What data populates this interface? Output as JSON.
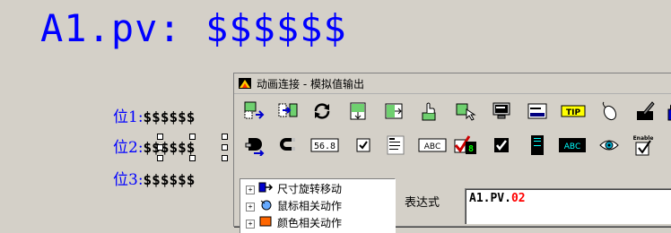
{
  "canvas": {
    "title_text": "A1.pv: $$$$$$",
    "positions": [
      {
        "label": "位1:",
        "value": "$$$$$$"
      },
      {
        "label": "位2:",
        "value": "$$$$$$"
      },
      {
        "label": "位3:",
        "value": "$$$$$$"
      }
    ]
  },
  "dialog": {
    "title": "动画连接 - 模拟值输出",
    "tree_items": [
      {
        "label": "尺寸旋转移动",
        "expander": "+"
      },
      {
        "label": "鼠标相关动作",
        "expander": "+"
      },
      {
        "label": "颜色相关动作",
        "expander": "+"
      }
    ],
    "expression_label": "表达式",
    "expression": {
      "variable": "A1",
      "dot": ".",
      "field": "PV",
      "suffix": ".",
      "index": "02"
    },
    "toolbar_row1": [
      "resize-icon",
      "move-icon",
      "rotate-icon",
      "fill-vertical-icon",
      "fill-horizontal-icon",
      "hand-click-icon",
      "drag-icon",
      "monitor-icon",
      "window-icon",
      "tip-icon",
      "mouse-icon",
      "pen-icon",
      "lock-icon"
    ],
    "toolbar_row2": [
      "toggle-icon",
      "magnet-icon",
      "numeric-output-icon",
      "checkbox-icon",
      "list-icon",
      "text-output-icon",
      "check-8-icon",
      "checkbox-dark-icon",
      "bar-display-icon",
      "abc-display-icon",
      "eye-icon",
      "enable-icon"
    ],
    "labels": {
      "numeric": "56.8",
      "text_abc": "ABC",
      "tip": "TIP",
      "enable": "Enable",
      "eight": "8"
    }
  }
}
